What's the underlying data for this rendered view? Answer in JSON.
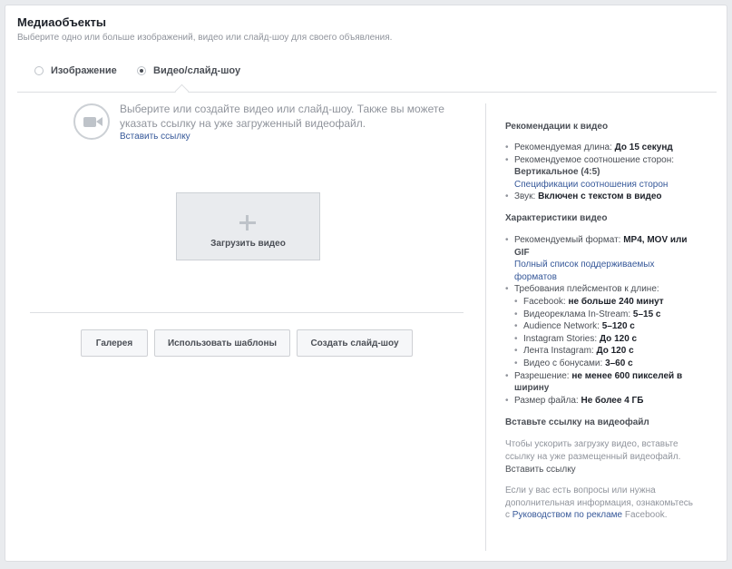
{
  "header": {
    "title": "Медиаобъекты",
    "subtitle": "Выберите одно или больше изображений, видео или слайд-шоу для своего объявления."
  },
  "media_type": {
    "options": [
      {
        "label": "Изображение",
        "selected": false
      },
      {
        "label": "Видео/слайд-шоу",
        "selected": true
      }
    ]
  },
  "intro": {
    "text": "Выберите или создайте видео или слайд-шоу. Также вы можете указать ссылку на уже загруженный видеофайл.",
    "link": "Вставить ссылку",
    "icon": "video-camera-icon"
  },
  "upload": {
    "label": "Загрузить видео",
    "icon": "plus-icon"
  },
  "buttons": {
    "gallery": "Галерея",
    "templates": "Использовать шаблоны",
    "slideshow": "Создать слайд-шоу"
  },
  "recommendations": {
    "title": "Рекомендации к видео",
    "items": [
      {
        "label": "Рекомендуемая длина:",
        "value": "До 15 секунд"
      },
      {
        "label": "Рекомендуемое соотношение сторон:",
        "value": "Вертикальное (4:5)",
        "link": "Спецификации соотношения сторон"
      },
      {
        "label": "Звук:",
        "value": "Включен с текстом в видео"
      }
    ]
  },
  "characteristics": {
    "title": "Характеристики видео",
    "format": {
      "label": "Рекомендуемый формат:",
      "value_line1": "MP4, MOV или",
      "value_line2": "GIF",
      "link_line1": "Полный список поддерживаемых",
      "link_line2": "форматов"
    },
    "placements": {
      "label": "Требования плейсментов к длине:",
      "items": [
        {
          "label": "Facebook:",
          "value": "не больше 240 минут"
        },
        {
          "label": "Видеореклама In-Stream:",
          "value": "5–15 с"
        },
        {
          "label": "Audience Network:",
          "value": "5–120 с"
        },
        {
          "label": "Instagram Stories:",
          "value": "До 120 с"
        },
        {
          "label": "Лента Instagram:",
          "value": "До 120 с"
        },
        {
          "label": "Видео с бонусами:",
          "value": "3–60 с"
        }
      ]
    },
    "resolution": {
      "label": "Разрешение:",
      "value_line1": "не менее 600 пикселей в",
      "value_line2": "ширину"
    },
    "filesize": {
      "label": "Размер файла:",
      "value": "Не более 4 ГБ"
    }
  },
  "paste_link": {
    "title": "Вставьте ссылку на видеофайл",
    "text": "Чтобы ускорить загрузку видео, вставьте ссылку на уже размещенный видеофайл.",
    "link": "Вставить ссылку"
  },
  "help": {
    "text_before": "Если у вас есть вопросы или нужна дополнительная информация, ознакомьтесь с ",
    "link": "Руководством по рекламе",
    "text_after": " Facebook."
  }
}
